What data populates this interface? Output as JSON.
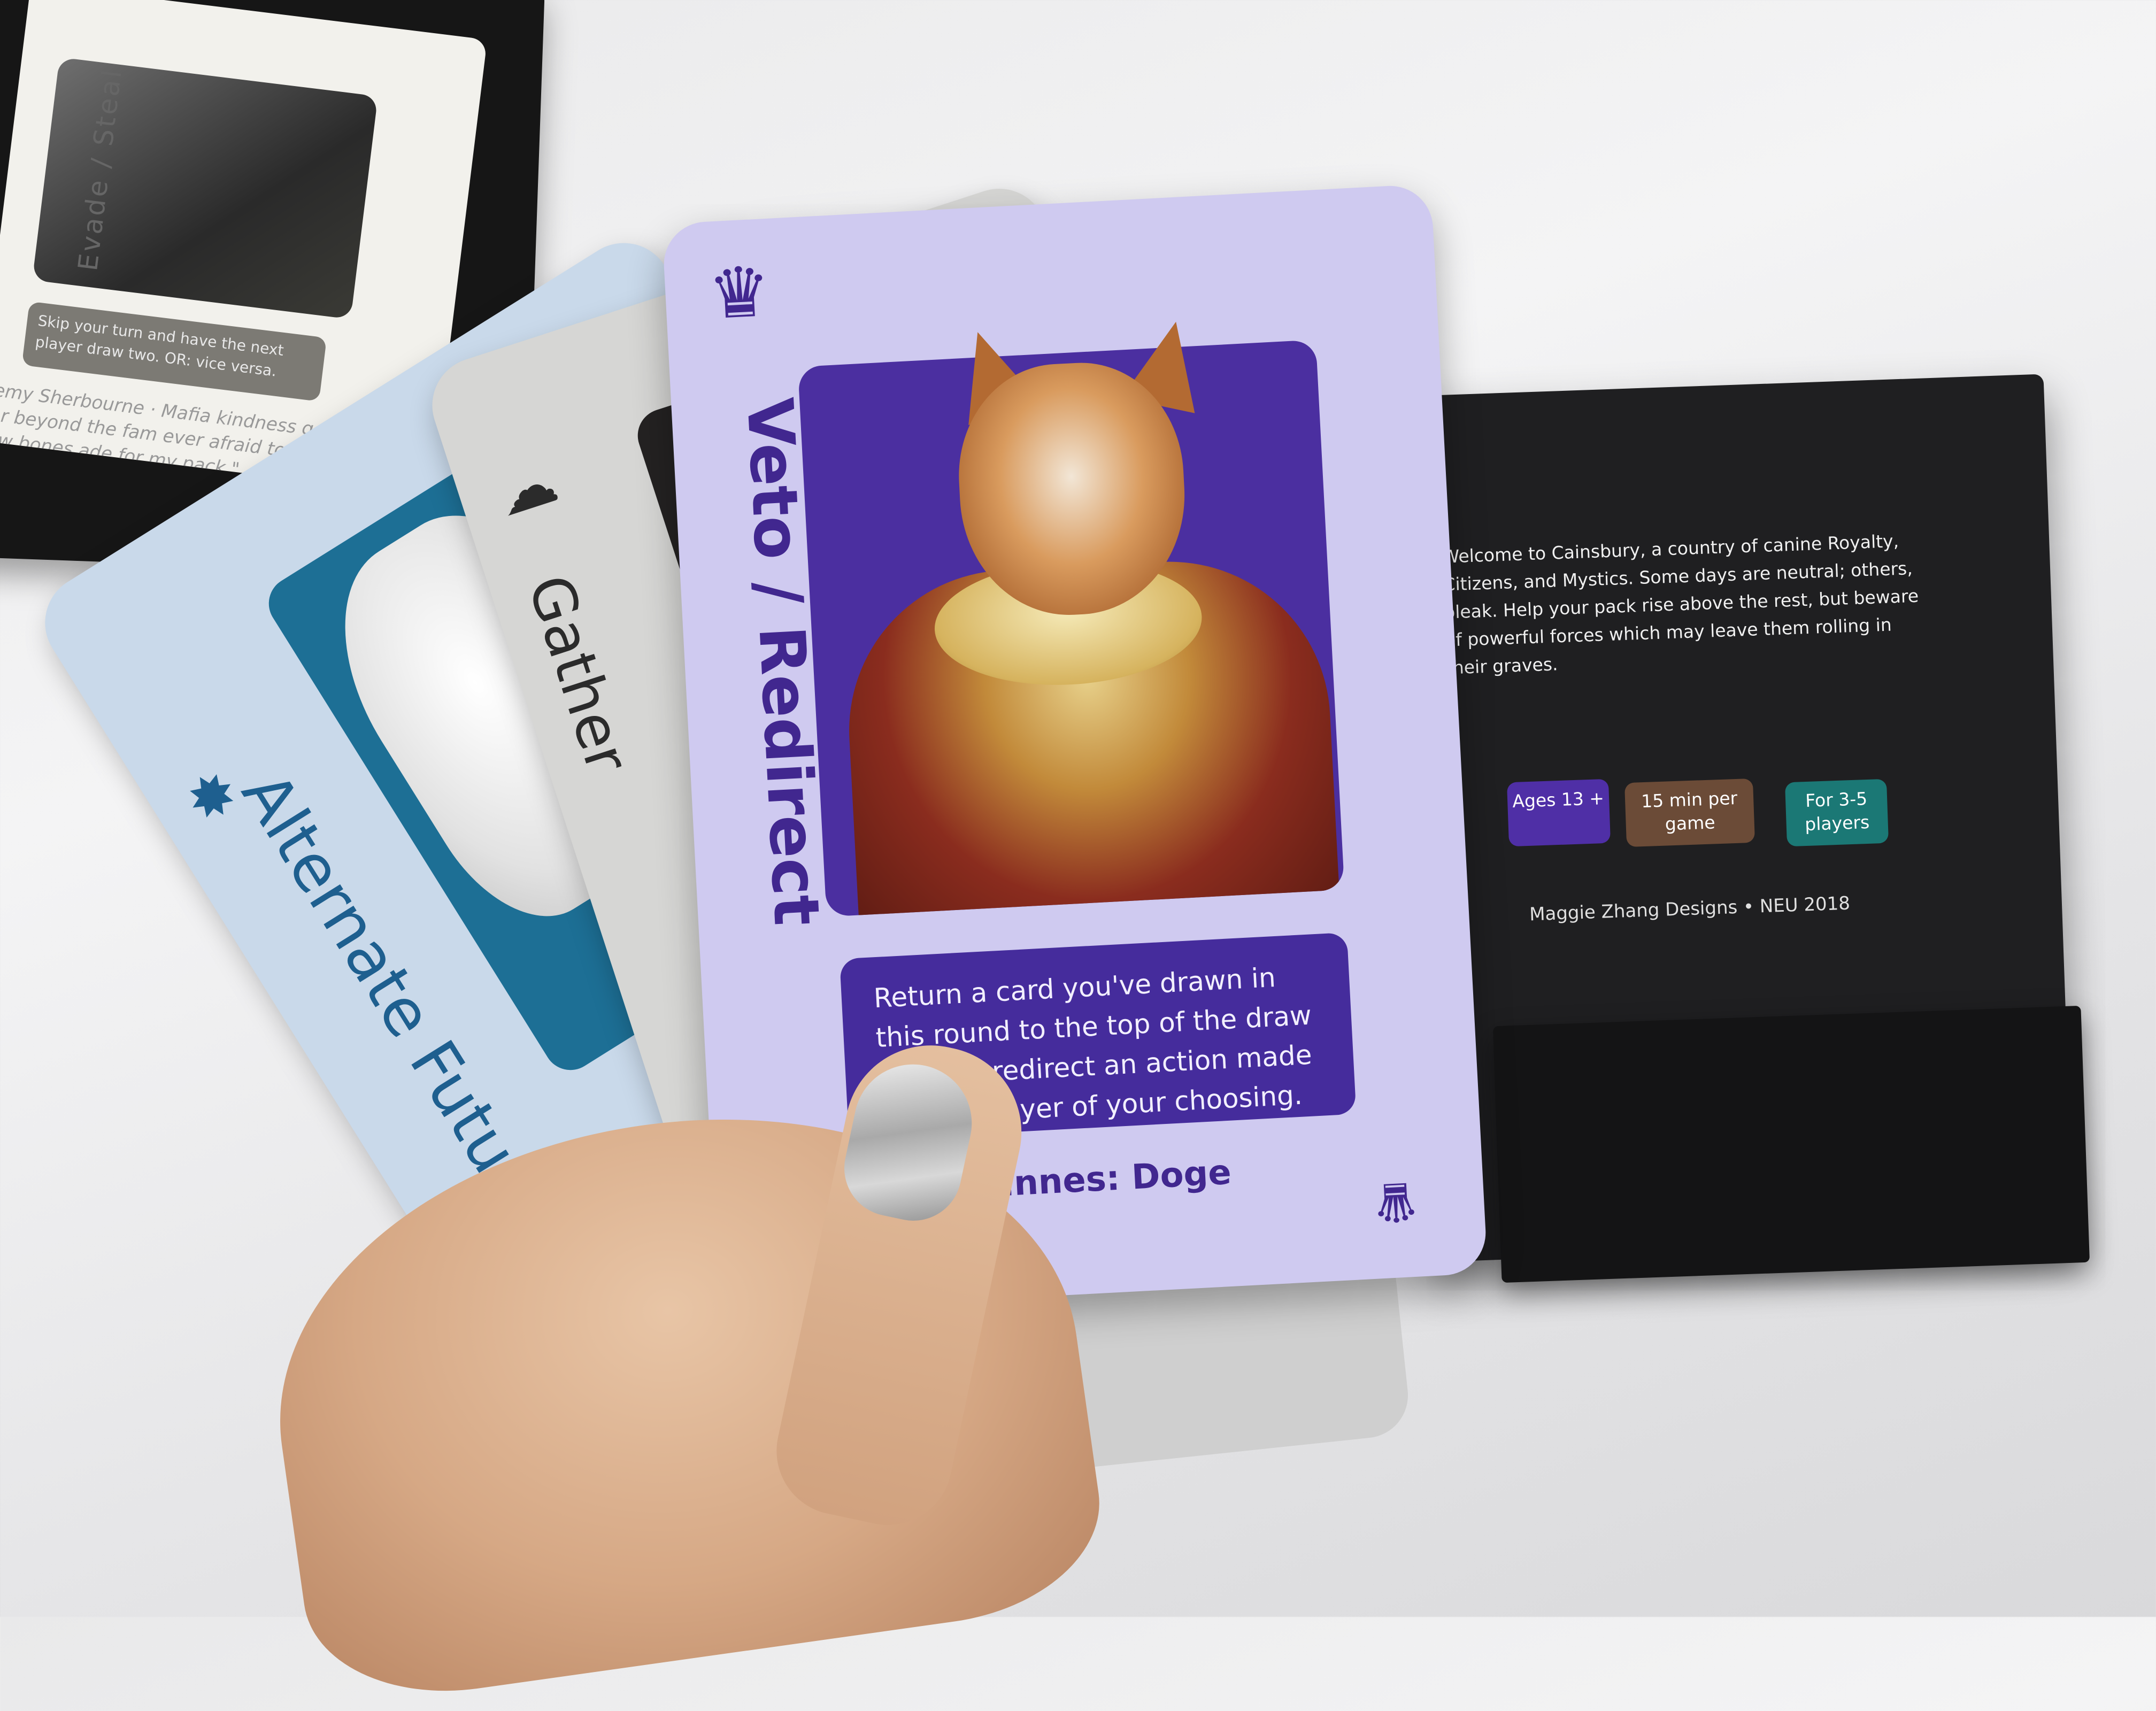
{
  "scene": {
    "background_color": "#eeeeef",
    "box_rules": {
      "intro": "Welcome to Cainsbury, a country of canine Royalty, Citizens, and Mystics. Some days are neutral; others, bleak. Help your pack rise above the rest, but beware of powerful forces which may leave them rolling in their graves.",
      "badges": [
        {
          "label": "Ages 13 +",
          "color": "#4f2fa6"
        },
        {
          "label": "15 min per game",
          "color": "#6b4b37"
        },
        {
          "label": "For 3-5 players",
          "color": "#1b7875"
        }
      ],
      "credits": "Maggie Zhang Designs  •  NEU 2018"
    },
    "box_card": {
      "title": "Evade / Steal",
      "description": "Skip your turn and have the next player draw two. OR: vice versa.",
      "quote": "remy Sherbourne · Mafia\nkindness goes far beyond the fam ever afraid to bend a few bones ade for my pack.\""
    },
    "cards": {
      "alternate_future": {
        "title": "Alternate Future",
        "icon": "sun-burst-icon",
        "color": "#1e5f8f"
      },
      "gather": {
        "title": "Gather",
        "icon": "sheep-icon",
        "color": "#2b2b2b"
      },
      "veto": {
        "title": "Veto / Redirect",
        "icon": "crown-icon",
        "description": "Return a card you've drawn in this round to the top of the draw pile. Or, redirect an action made on you player of your choosing.",
        "credit": "Innes: Doge",
        "color": "#41278f"
      }
    }
  }
}
